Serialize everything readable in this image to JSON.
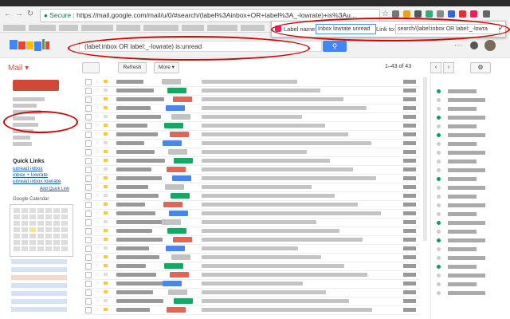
{
  "browser": {
    "secure_label": "Secure",
    "url": "https://mail.google.com/mail/u/0/#search/(label%3Ainbox+OR+label%3A_-lowrate)+is%3Au..."
  },
  "popup": {
    "label_name_caption": "Label name:",
    "label_name_value": "Inbox lowrate unread",
    "link_to_caption": "Link to:",
    "link_to_value": "search/(label:inbox OR label:_-lowra"
  },
  "gmail": {
    "search_query": "(label:inbox OR label:_-lowrate) is:unread",
    "mail_label": "Mail",
    "refresh_label": "Refresh",
    "more_label": "More",
    "page_count": "1–43 of 43"
  },
  "quick_links": {
    "title": "Quick Links",
    "items": [
      "unread inbox",
      "inbox + lowrate",
      "unread inbox lowrate"
    ],
    "add_label": "Add Quick Link"
  },
  "calendar": {
    "title": "Google Calendar"
  },
  "colors": {
    "accent": "#4285f4",
    "gmail_red": "#dd4b39",
    "compose": "#d14836",
    "annotation_red": "#dd0000",
    "tag_green": "#16a765",
    "tag_red": "#e66550",
    "tag_blue": "#4a86e8",
    "tag_grey": "#c2c2c2"
  }
}
